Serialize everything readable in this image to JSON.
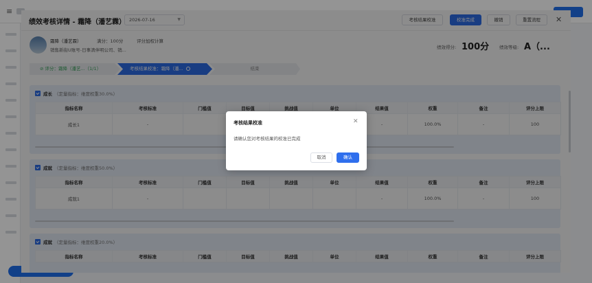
{
  "drawer": {
    "title": "绩效考核详情 - 霜降（潘艺霖）",
    "date_value": "2026-07-16",
    "buttons": {
      "result_calibration": "考核结果校准",
      "calibration_done": "校准完成",
      "revoke": "撤销",
      "reset_flow": "重置流程"
    }
  },
  "employee": {
    "name": "霜降（潘艺霖）",
    "full_score": "满分：100分",
    "scoring_method": "评分加权计算",
    "department": "销售新街U账号-日事清伴明公司、销...",
    "score_label": "绩效得分:",
    "score_value": "100分",
    "grade_label": "绩效等级:",
    "grade_value": "A（..."
  },
  "steps": [
    {
      "label": "评分：霜降（潘艺...（1/1）",
      "status": "done"
    },
    {
      "label": "考核结果校准：霜降（潘...",
      "status": "current"
    },
    {
      "label": "结束",
      "status": "pending"
    }
  ],
  "columns": [
    "指标名称",
    "考核标准",
    "门槛值",
    "目标值",
    "挑战值",
    "单位",
    "结果值",
    "权重",
    "备注",
    "评分上限"
  ],
  "sections": [
    {
      "name": "成长",
      "weight_note": "（定量指标：维度权重30.0%）",
      "rows": [
        [
          "成长1",
          "-",
          "",
          "",
          "",
          "",
          "-",
          "100.0%",
          "-",
          "100"
        ]
      ]
    },
    {
      "name": "成就",
      "weight_note": "（定量指标：维度权重50.0%）",
      "rows": [
        [
          "成就1",
          "-",
          "",
          "",
          "",
          "",
          "-",
          "100.0%",
          "-",
          "100"
        ]
      ]
    },
    {
      "name": "成就",
      "weight_note": "（定量指标：维度权重20.0%）",
      "rows": []
    }
  ],
  "modal": {
    "title": "考核结果校准",
    "message": "请确认您对考核结果的校准已完成",
    "cancel": "取消",
    "confirm": "确认"
  },
  "colors": {
    "primary": "#2f6fed",
    "success": "#3aa55d",
    "section_bg": "#eaf0fb"
  }
}
